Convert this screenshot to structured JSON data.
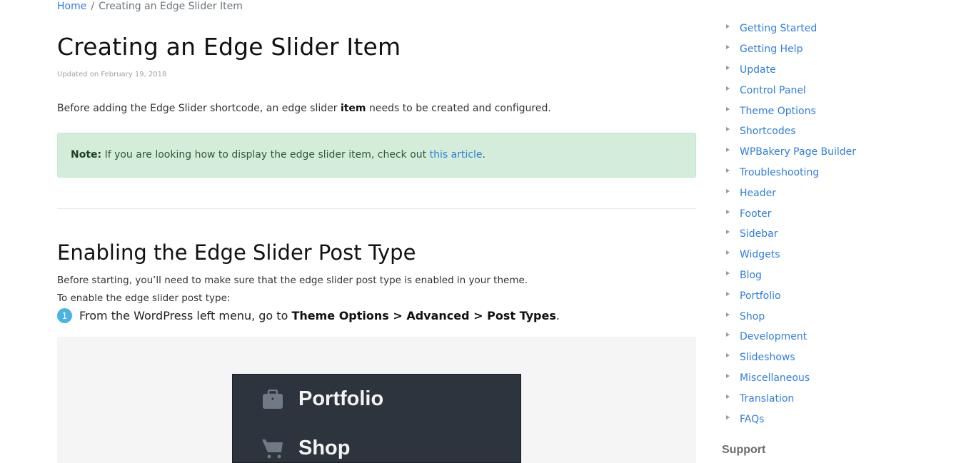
{
  "breadcrumb": {
    "home": "Home",
    "separator": "/",
    "current": "Creating an Edge Slider Item"
  },
  "article": {
    "title": "Creating an Edge Slider Item",
    "updated": "Updated on February 19, 2018",
    "intro": {
      "before": "Before adding the Edge Slider shortcode, an edge slider ",
      "bold": "item",
      "after": " needs to be created and configured."
    },
    "note": {
      "label": "Note:",
      "text": " If you are looking how to display the edge slider item, check out ",
      "link": "this article",
      "end": "."
    },
    "section": {
      "heading": "Enabling the Edge Slider Post Type",
      "p1": "Before starting, you’ll need to make sure that the edge slider post type is enabled in your theme.",
      "p2": "To enable the edge slider post type:",
      "step": {
        "number": "1",
        "before": "From the WordPress left menu, go to ",
        "bold": "Theme Options > Advanced > Post Types",
        "after": "."
      }
    },
    "figure": {
      "menu_items": [
        {
          "label": "Portfolio",
          "icon": "briefcase-icon"
        },
        {
          "label": "Shop",
          "icon": "cart-icon"
        }
      ]
    }
  },
  "sidebar": {
    "items": [
      {
        "label": "Getting Started"
      },
      {
        "label": "Getting Help"
      },
      {
        "label": "Update"
      },
      {
        "label": "Control Panel"
      },
      {
        "label": "Theme Options"
      },
      {
        "label": "Shortcodes"
      },
      {
        "label": "WPBakery Page Builder"
      },
      {
        "label": "Troubleshooting"
      },
      {
        "label": "Header"
      },
      {
        "label": "Footer"
      },
      {
        "label": "Sidebar"
      },
      {
        "label": "Widgets"
      },
      {
        "label": "Blog"
      },
      {
        "label": "Portfolio"
      },
      {
        "label": "Shop"
      },
      {
        "label": "Development"
      },
      {
        "label": "Slideshows"
      },
      {
        "label": "Miscellaneous"
      },
      {
        "label": "Translation"
      },
      {
        "label": "FAQs"
      }
    ],
    "support_heading": "Support"
  },
  "colors": {
    "link": "#2f7fd8",
    "note_bg": "#d4edda",
    "step_badge": "#4ab3e3",
    "figure_dark": "#2d343d"
  }
}
